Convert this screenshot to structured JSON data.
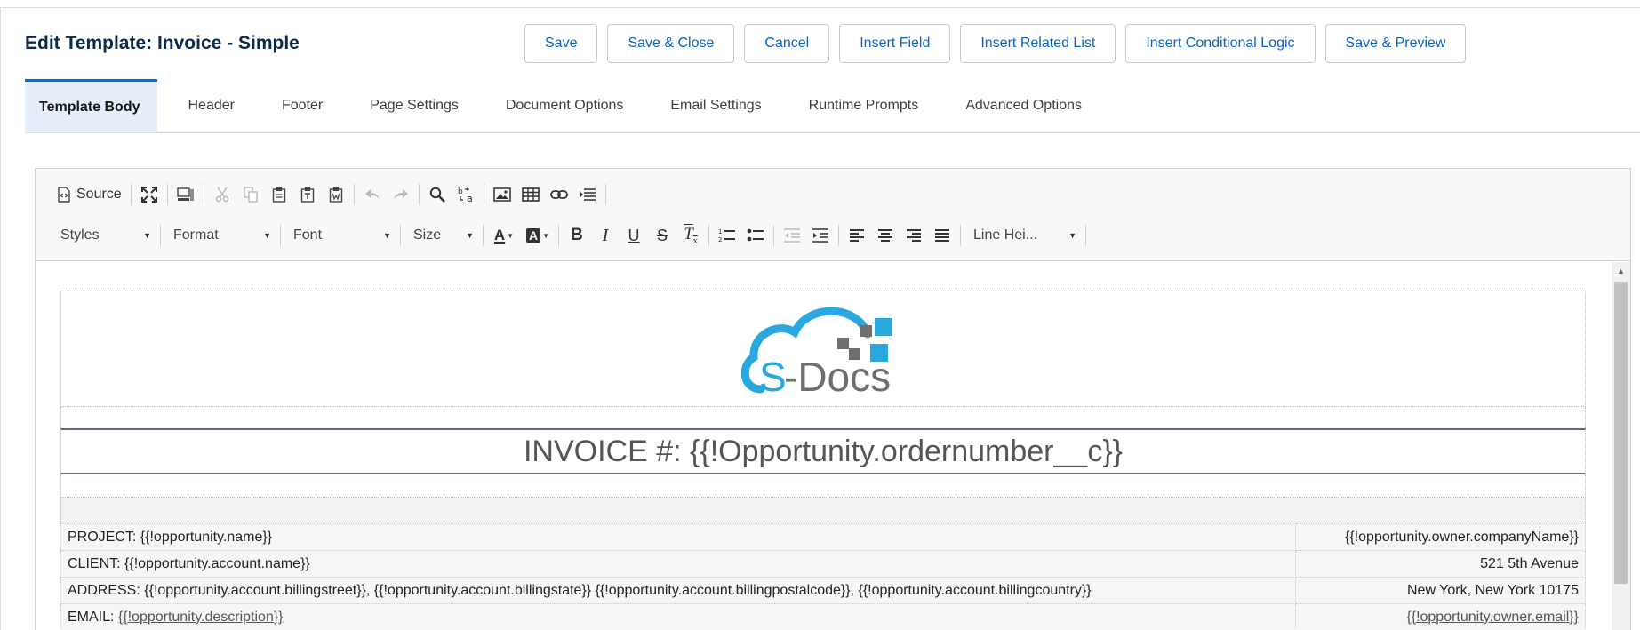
{
  "header": {
    "title": "Edit Template: Invoice - Simple"
  },
  "actions": [
    "Save",
    "Save & Close",
    "Cancel",
    "Insert Field",
    "Insert Related List",
    "Insert Conditional Logic",
    "Save & Preview"
  ],
  "tabs": [
    "Template Body",
    "Header",
    "Footer",
    "Page Settings",
    "Document Options",
    "Email Settings",
    "Runtime Prompts",
    "Advanced Options"
  ],
  "active_tab": "Template Body",
  "toolbar": {
    "source_label": "Source",
    "styles": "Styles",
    "format": "Format",
    "font": "Font",
    "size": "Size",
    "line_height": "Line Hei..."
  },
  "document": {
    "logo": {
      "text": "S-Docs",
      "accent": "#29a7df",
      "gray": "#6d6e70"
    },
    "invoice_title": "INVOICE #: {{!Opportunity.ordernumber__c}}",
    "rows": [
      {
        "left_label": "PROJECT: ",
        "left_value": "{{!opportunity.name}}",
        "right": "{{!opportunity.owner.companyName}}"
      },
      {
        "left_label": "CLIENT: ",
        "left_value": "{{!opportunity.account.name}}",
        "right": "521 5th Avenue"
      },
      {
        "left_label": "ADDRESS: ",
        "left_value": "{{!opportunity.account.billingstreet}}, {{!opportunity.account.billingstate}} {{!opportunity.account.billingpostalcode}}, {{!opportunity.account.billingcountry}}",
        "right": "New York, New York 10175"
      },
      {
        "left_label": "EMAIL: ",
        "left_value": "{{!opportunity.description}}",
        "right": "{{!opportunity.owner.email}}"
      }
    ]
  },
  "colors": {
    "title": "#0b2a4a",
    "link": "#0b63c5",
    "tab_active_bg": "#e6eef9",
    "tab_active_border": "#0070d2"
  }
}
